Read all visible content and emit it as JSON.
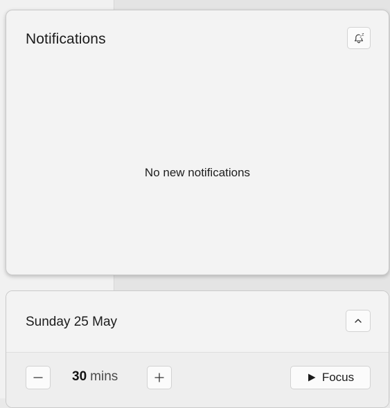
{
  "notifications": {
    "title": "Notifications",
    "empty_message": "No new notifications",
    "snooze_icon": "bell-snooze-icon"
  },
  "calendar": {
    "date_label": "Sunday 25 May",
    "expand_icon": "chevron-up-icon"
  },
  "focus": {
    "minus_label": "−",
    "duration_value": "30",
    "duration_unit": "mins",
    "plus_label": "+",
    "button_label": "Focus",
    "button_icon": "play-icon"
  }
}
